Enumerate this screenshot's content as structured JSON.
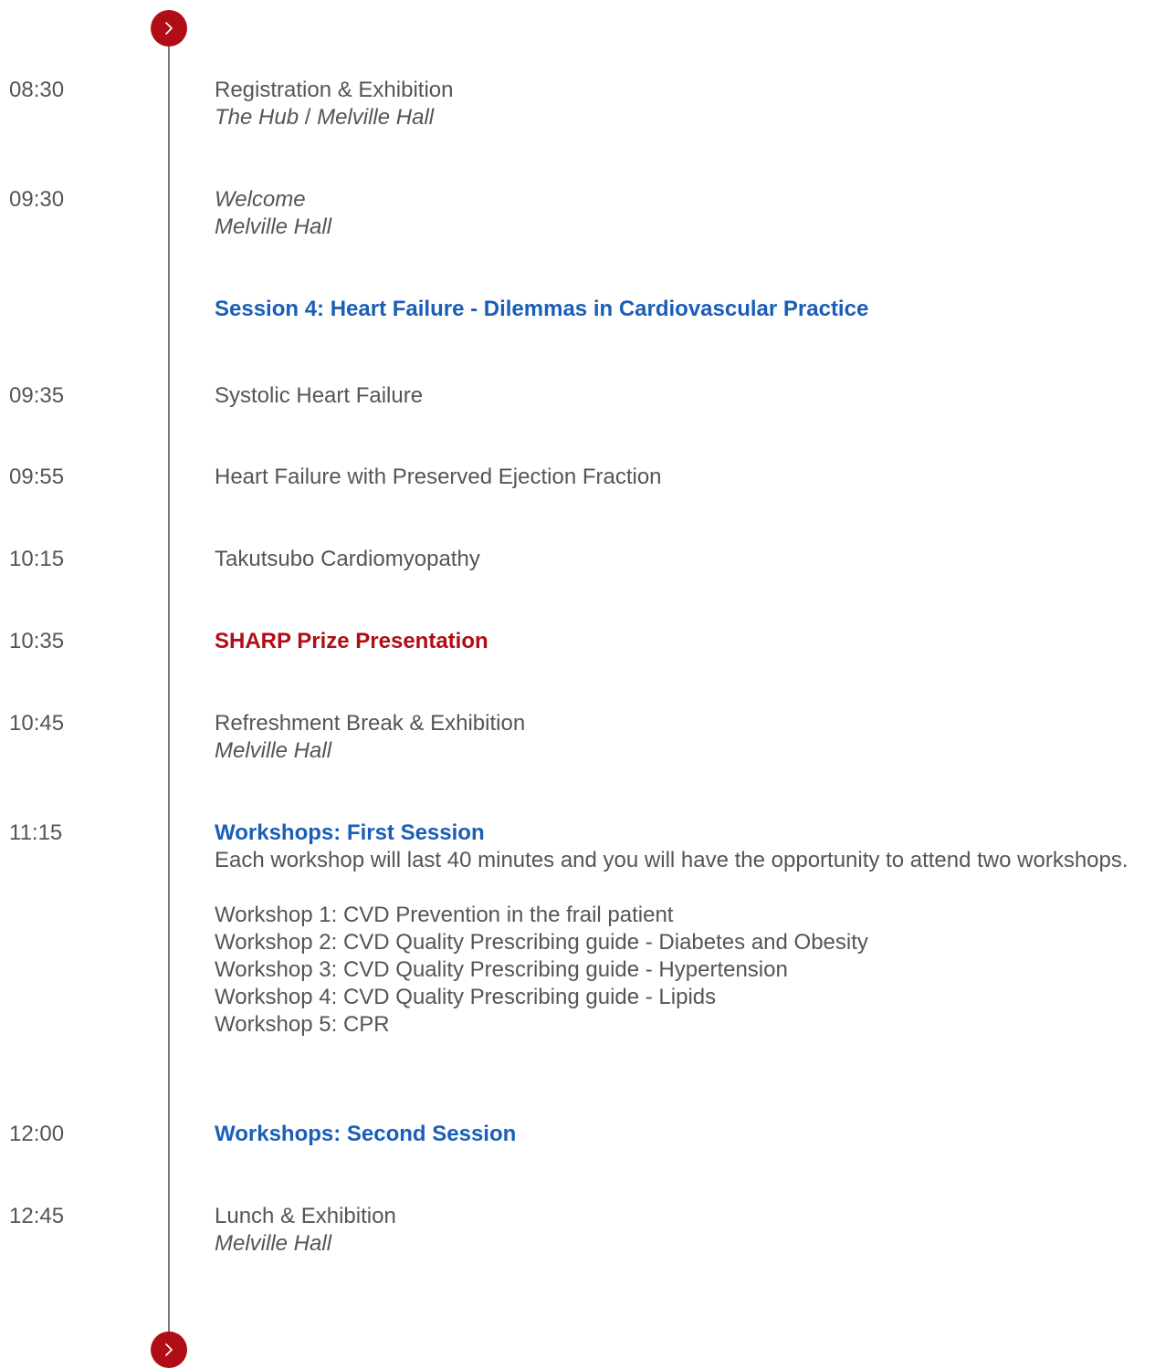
{
  "colors": {
    "accent_red": "#b10d16",
    "accent_blue": "#1a5eb8",
    "text": "#555555",
    "timeline": "#7a7a7a"
  },
  "icons": {
    "nav_top": "chevron-right-icon",
    "nav_bottom": "chevron-right-icon"
  },
  "agenda": [
    {
      "time": "08:30",
      "title": "Registration & Exhibition",
      "loc_a": "The Hub",
      "loc_sep": "/",
      "loc_b": "Melville Hall"
    },
    {
      "time": "09:30",
      "title": "Welcome",
      "location": "Melville Hall"
    },
    {
      "title": "Session 4: Heart Failure - Dilemmas in Cardiovascular Practice"
    },
    {
      "time": "09:35",
      "title": "Systolic Heart Failure"
    },
    {
      "time": "09:55",
      "title": "Heart Failure with Preserved Ejection Fraction"
    },
    {
      "time": "10:15",
      "title": "Takutsubo Cardiomyopathy"
    },
    {
      "time": "10:35",
      "title": "SHARP Prize Presentation"
    },
    {
      "time": "10:45",
      "title": "Refreshment Break & Exhibition",
      "location": "Melville Hall"
    },
    {
      "time": "11:15",
      "title": "Workshops: First Session",
      "description": "Each workshop will last 40 minutes and you will have the opportunity to attend two workshops.",
      "workshops": [
        "Workshop 1: CVD Prevention in the frail patient",
        "Workshop 2: CVD Quality Prescribing guide - Diabetes and Obesity",
        "Workshop 3: CVD Quality Prescribing guide - Hypertension",
        "Workshop 4: CVD Quality Prescribing guide - Lipids",
        "Workshop 5: CPR"
      ]
    },
    {
      "time": "12:00",
      "title": "Workshops: Second Session"
    },
    {
      "time": "12:45",
      "title": "Lunch & Exhibition",
      "location": "Melville Hall"
    }
  ]
}
